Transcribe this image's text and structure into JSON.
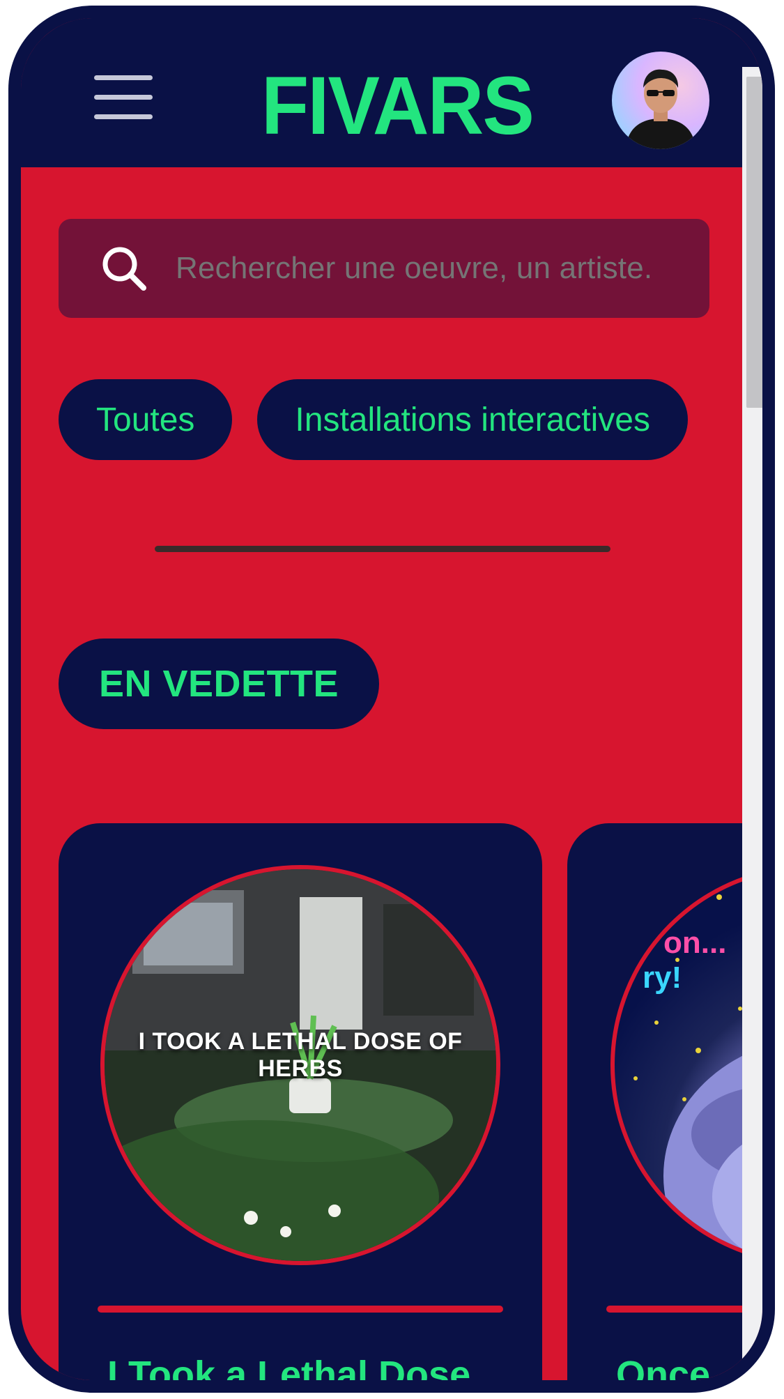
{
  "header": {
    "logo_text": "FIVARS",
    "menu_icon": "hamburger-menu-icon",
    "avatar_icon": "user-avatar"
  },
  "search": {
    "icon": "search-icon",
    "placeholder": "Rechercher une oeuvre, un artiste."
  },
  "filters": [
    {
      "label": "Toutes"
    },
    {
      "label": "Installations interactives"
    }
  ],
  "featured": {
    "badge_label": "EN VEDETTE"
  },
  "cards": [
    {
      "image_caption": "I TOOK A LETHAL DOSE OF HERBS",
      "title": "I Took a Lethal Dose"
    },
    {
      "title": "Once"
    }
  ],
  "colors": {
    "navy": "#0a1146",
    "red": "#d7152f",
    "green_accent": "#23e57f",
    "search_bg": "#731238"
  }
}
